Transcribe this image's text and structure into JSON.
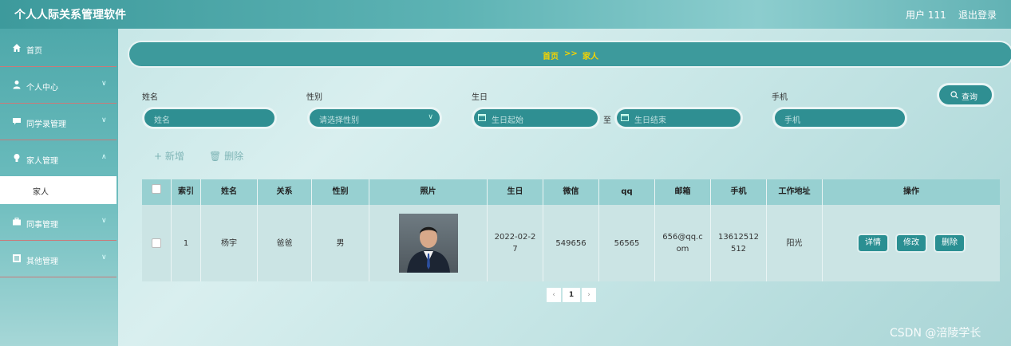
{
  "header": {
    "title": "个人人际关系管理软件",
    "user": "用户 111",
    "logout": "退出登录"
  },
  "sidebar": {
    "items": [
      {
        "label": "首页",
        "icon": "home-icon"
      },
      {
        "label": "个人中心",
        "icon": "user-icon"
      },
      {
        "label": "同学录管理",
        "icon": "chat-icon"
      },
      {
        "label": "家人管理",
        "icon": "bulb-icon"
      },
      {
        "label": "同事管理",
        "icon": "briefcase-icon"
      },
      {
        "label": "其他管理",
        "icon": "list-icon"
      }
    ],
    "active_sub": "家人"
  },
  "breadcrumb": {
    "home": "首页",
    "sep": ">>",
    "current": "家人"
  },
  "search": {
    "name_label": "姓名",
    "name_placeholder": "姓名",
    "gender_label": "性别",
    "gender_placeholder": "请选择性别",
    "birthday_label": "生日",
    "birth_start_placeholder": "生日起始",
    "to": "至",
    "birth_end_placeholder": "生日结束",
    "phone_label": "手机",
    "phone_placeholder": "手机",
    "query_button": "查询"
  },
  "actions": {
    "add": "+ 新增",
    "delete": "删除"
  },
  "table": {
    "headers": [
      "索引",
      "姓名",
      "关系",
      "性别",
      "照片",
      "生日",
      "微信",
      "qq",
      "邮箱",
      "手机",
      "工作地址",
      "操作"
    ],
    "rows": [
      {
        "index": "1",
        "name": "杨宇",
        "relation": "爸爸",
        "gender": "男",
        "birthday": "2022-02-27",
        "wechat": "549656",
        "qq": "56565",
        "email": "656@qq.com",
        "phone": "13612512512",
        "address": "阳光"
      }
    ],
    "row_buttons": {
      "detail": "详情",
      "edit": "修改",
      "delete": "删除"
    }
  },
  "pagination": {
    "prev": "‹",
    "current": "1",
    "next": "›"
  },
  "watermark": "CSDN @涪陵学长",
  "colors": {
    "accent": "#2f8f92",
    "breadcrumb_text": "#f4d300"
  }
}
